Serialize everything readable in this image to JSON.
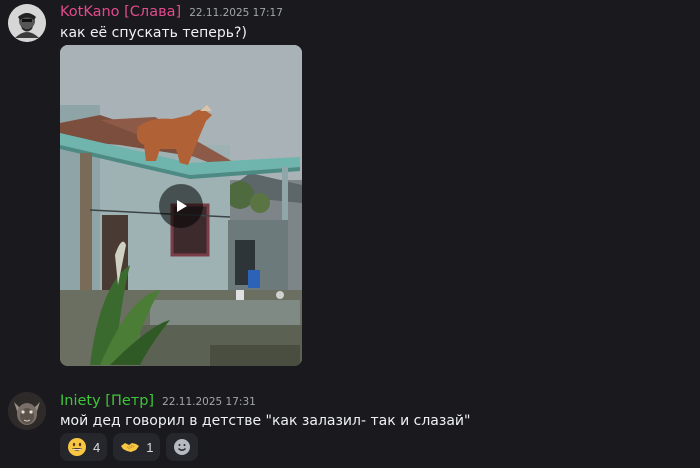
{
  "messages": [
    {
      "author": "KotKano [Слава]",
      "author_color": "#e24a8d",
      "timestamp": "22.11.2025 17:17",
      "text": "как её спускать теперь?)",
      "attachment": {
        "kind": "video",
        "icon": "play-icon"
      }
    },
    {
      "author": "Iniety [Петр]",
      "author_color": "#3fc53a",
      "timestamp": "22.11.2025 17:31",
      "text": "мой дед говорил в детстве \"как залазил- так и слазай\"",
      "reactions": [
        {
          "icon": "grinning-face-icon",
          "count": "4"
        },
        {
          "icon": "handshake-icon",
          "count": "1"
        },
        {
          "icon": "add-reaction-icon"
        }
      ]
    }
  ]
}
